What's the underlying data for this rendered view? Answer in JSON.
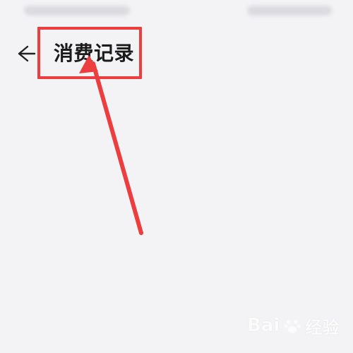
{
  "header": {
    "title": "消费记录"
  },
  "icons": {
    "back": "arrow-left-icon",
    "watermark": "paw-icon"
  },
  "annotation": {
    "color": "#ec3e3e"
  },
  "watermark": {
    "brand_left": "Bai",
    "brand_right": "经验"
  }
}
